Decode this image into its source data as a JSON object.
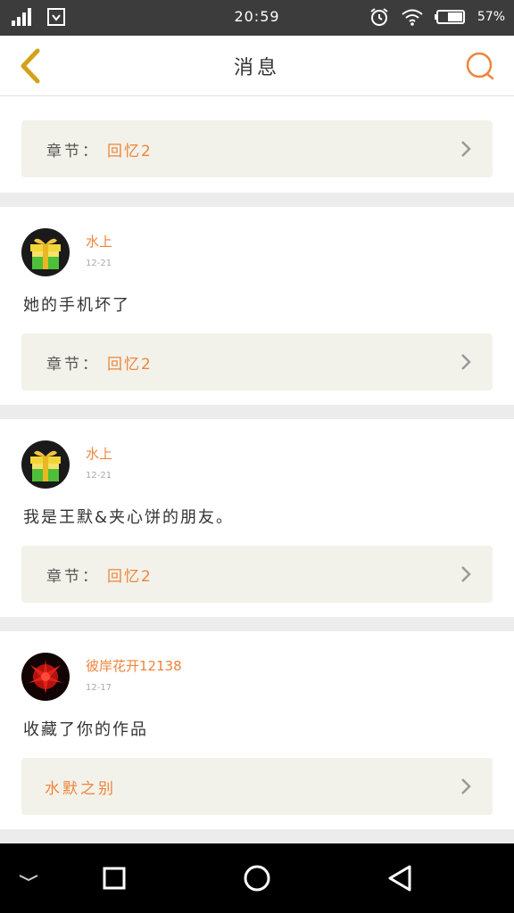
{
  "status_bar": {
    "time": "20:59",
    "battery": "57%"
  },
  "header": {
    "title": "消息"
  },
  "chapter_label": "章节：",
  "messages": [
    {
      "partial": true,
      "chapter": "回忆2"
    },
    {
      "username": "水上",
      "date": "12-21",
      "text": "她的手机坏了",
      "chapter": "回忆2"
    },
    {
      "username": "水上",
      "date": "12-21",
      "text": "我是王默&夹心饼的朋友。",
      "chapter": "回忆2"
    },
    {
      "username": "彼岸花开12138",
      "date": "12-17",
      "text": "收藏了你的作品",
      "work": "水默之别"
    }
  ],
  "colors": {
    "accent": "#f0843a",
    "back_arrow": "#d4a21a",
    "card_bg": "#f2f2ea"
  }
}
